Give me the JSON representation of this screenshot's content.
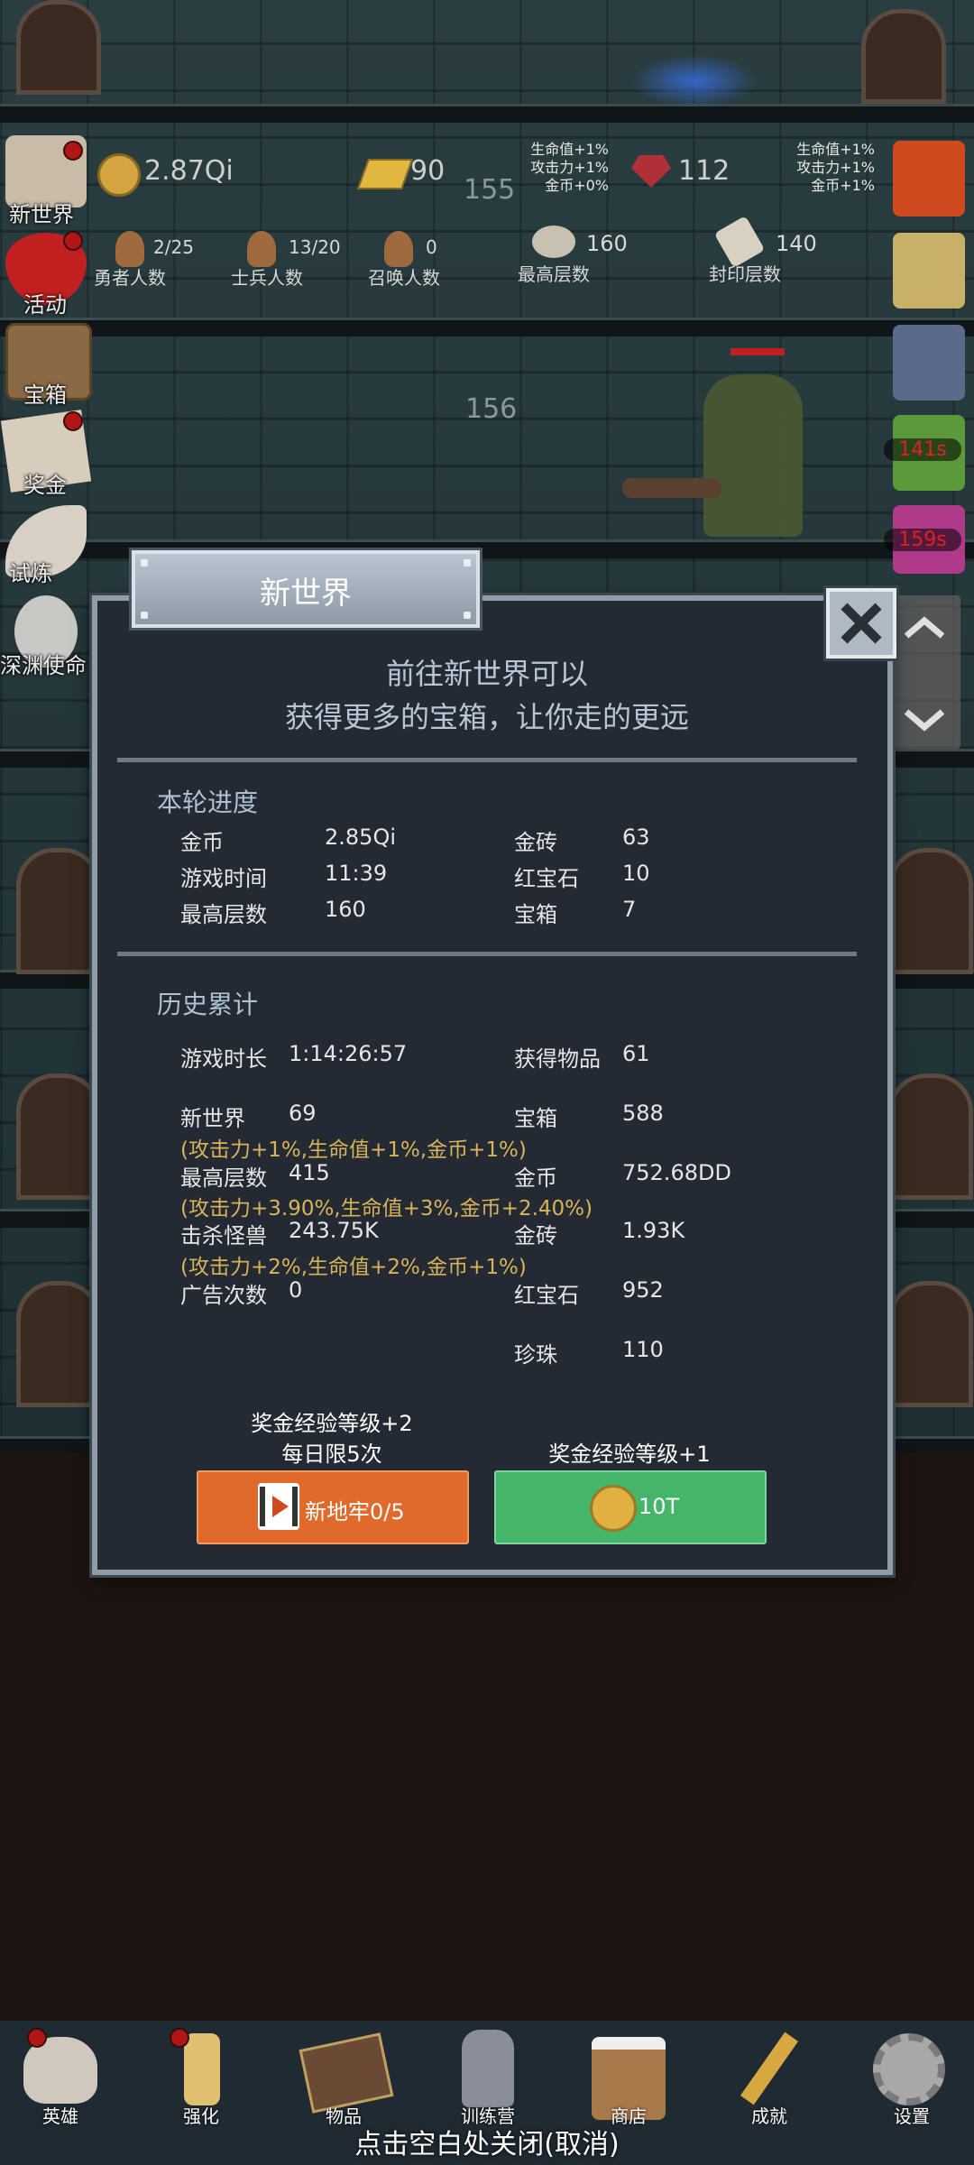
{
  "top": {
    "gold": "2.87Qi",
    "brick": "90",
    "ruby": "112",
    "floor_a": "155",
    "floor_b": "156",
    "buff_left": [
      "生命值+1%",
      "攻击力+1%",
      "金币+0%"
    ],
    "buff_right": [
      "生命值+1%",
      "攻击力+1%",
      "金币+1%"
    ],
    "counts": [
      {
        "value": "2/25",
        "label": "勇者人数"
      },
      {
        "value": "13/20",
        "label": "士兵人数"
      },
      {
        "value": "0",
        "label": "召唤人数"
      },
      {
        "value": "160",
        "label": "最高层数"
      },
      {
        "value": "140",
        "label": "封印层数"
      }
    ],
    "timers": [
      "141s",
      "159s"
    ]
  },
  "sidebar": {
    "items": [
      {
        "label": "新世界",
        "icon": "new-world-icon"
      },
      {
        "label": "活动",
        "icon": "heart-icon"
      },
      {
        "label": "宝箱",
        "icon": "chest-icon"
      },
      {
        "label": "奖金",
        "icon": "envelope-icon"
      },
      {
        "label": "试炼",
        "icon": "feather-icon"
      },
      {
        "label": "深渊使命",
        "icon": "orb-icon"
      }
    ]
  },
  "modal": {
    "title": "新世界",
    "intro_line1": "前往新世界可以",
    "intro_line2": "获得更多的宝箱，让你走的更远",
    "round": {
      "heading": "本轮进度",
      "rows": [
        {
          "label": "金币",
          "value": "2.85Qi"
        },
        {
          "label": "游戏时间",
          "value": "11:39"
        },
        {
          "label": "最高层数",
          "value": "160"
        },
        {
          "label": "金砖",
          "value": "63"
        },
        {
          "label": "红宝石",
          "value": "10"
        },
        {
          "label": "宝箱",
          "value": "7"
        }
      ]
    },
    "history": {
      "heading": "历史累计",
      "play_time_label": "游戏时长",
      "play_time": "1:14:26:57",
      "items_label": "获得物品",
      "items": "61",
      "new_world_label": "新世界",
      "new_world": "69",
      "chest_label": "宝箱",
      "chest": "588",
      "bonus1": "(攻击力+1%,生命值+1%,金币+1%)",
      "max_floor_label": "最高层数",
      "max_floor": "415",
      "gold_label": "金币",
      "gold": "752.68DD",
      "bonus2": "(攻击力+3.90%,生命值+3%,金币+2.40%)",
      "kills_label": "击杀怪兽",
      "kills": "243.75K",
      "brick_label": "金砖",
      "brick": "1.93K",
      "bonus3": "(攻击力+2%,生命值+2%,金币+1%)",
      "ads_label": "广告次数",
      "ads": "0",
      "ruby_label": "红宝石",
      "ruby": "952",
      "pearl_label": "珍珠",
      "pearl": "110"
    },
    "left_option": {
      "note1": "奖金经验等级+2",
      "note2": "每日限5次",
      "button": "新地牢0/5",
      "color": "#e06a2c"
    },
    "right_option": {
      "note1": "奖金经验等级+1",
      "button": "10T",
      "color": "#45b56a"
    }
  },
  "bottom_nav": {
    "items": [
      {
        "label": "英雄",
        "icon": "skull-icon"
      },
      {
        "label": "强化",
        "icon": "candle-icon"
      },
      {
        "label": "物品",
        "icon": "book-icon"
      },
      {
        "label": "训练营",
        "icon": "lantern-icon"
      },
      {
        "label": "商店",
        "icon": "mug-icon"
      },
      {
        "label": "成就",
        "icon": "key-icon"
      },
      {
        "label": "设置",
        "icon": "gear-icon"
      }
    ],
    "hint": "点击空白处关闭(取消)"
  }
}
